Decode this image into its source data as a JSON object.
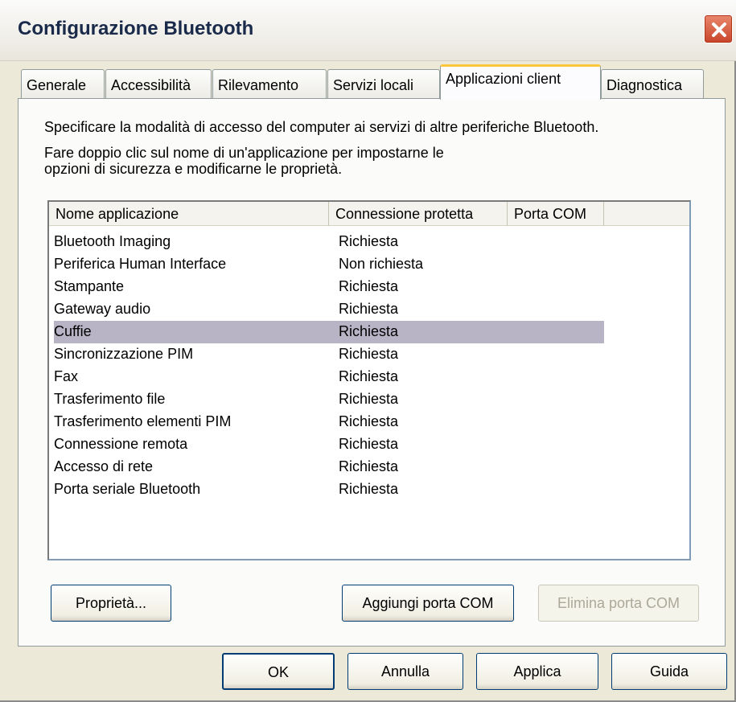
{
  "window": {
    "title": "Configurazione Bluetooth"
  },
  "tabs": [
    {
      "label": "Generale"
    },
    {
      "label": "Accessibilità"
    },
    {
      "label": "Rilevamento"
    },
    {
      "label": "Servizi locali"
    },
    {
      "label": "Applicazioni client",
      "active": true
    },
    {
      "label": "Diagnostica"
    }
  ],
  "panel": {
    "description_line1": "Specificare la modalità di accesso del computer ai servizi di altre periferiche Bluetooth.",
    "description_line2": "Fare doppio clic sul nome di un'applicazione per impostarne le",
    "description_line3": "opzioni di sicurezza e modificarne le proprietà.",
    "list": {
      "columns": [
        "Nome applicazione",
        "Connessione protetta",
        "Porta COM"
      ],
      "rows": [
        {
          "name": "Bluetooth Imaging",
          "secure": "Richiesta",
          "port": ""
        },
        {
          "name": "Periferica Human Interface",
          "secure": "Non richiesta",
          "port": ""
        },
        {
          "name": "Stampante",
          "secure": "Richiesta",
          "port": ""
        },
        {
          "name": "Gateway audio",
          "secure": "Richiesta",
          "port": ""
        },
        {
          "name": "Cuffie",
          "secure": "Richiesta",
          "port": "",
          "selected": true
        },
        {
          "name": "Sincronizzazione PIM",
          "secure": "Richiesta",
          "port": ""
        },
        {
          "name": "Fax",
          "secure": "Richiesta",
          "port": ""
        },
        {
          "name": "Trasferimento file",
          "secure": "Richiesta",
          "port": ""
        },
        {
          "name": "Trasferimento elementi PIM",
          "secure": "Richiesta",
          "port": ""
        },
        {
          "name": "Connessione remota",
          "secure": "Richiesta",
          "port": ""
        },
        {
          "name": "Accesso di rete",
          "secure": "Richiesta",
          "port": ""
        },
        {
          "name": "Porta seriale Bluetooth",
          "secure": "Richiesta",
          "port": ""
        }
      ]
    },
    "buttons": {
      "properties": "Proprietà...",
      "add_port": "Aggiungi porta COM",
      "remove_port": "Elimina porta COM"
    }
  },
  "footer": {
    "ok": "OK",
    "cancel": "Annulla",
    "apply": "Applica",
    "help": "Guida"
  },
  "colors": {
    "selection": "#b8b4c6",
    "active_tab_highlight": "#ffc83c",
    "close_button": "#c8452a"
  }
}
